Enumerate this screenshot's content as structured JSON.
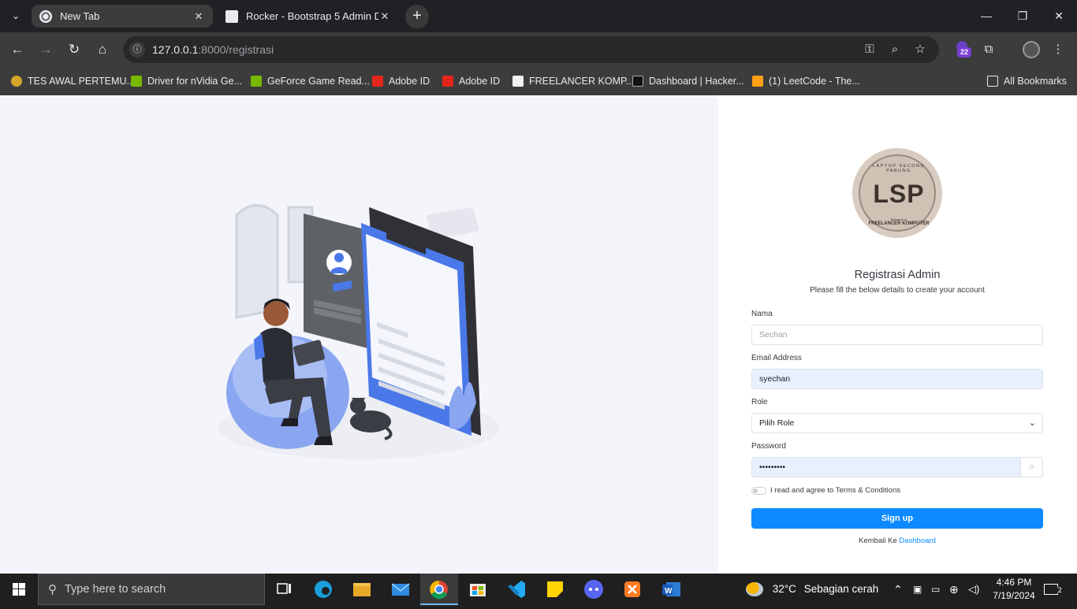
{
  "browser": {
    "tabs": [
      {
        "title": "New Tab",
        "active": true
      },
      {
        "title": "Rocker - Bootstrap 5 Admin Da",
        "active": false
      }
    ],
    "url_host": "127.0.0.1",
    "url_path": ":8000/registrasi",
    "extension_badge": "22",
    "bookmarks": [
      "TES AWAL PERTEMU...",
      "Driver for nVidia Ge...",
      "GeForce Game Read...",
      "Adobe ID",
      "Adobe ID",
      "FREELANCER KOMP...",
      "Dashboard | Hacker...",
      "(1) LeetCode - The..."
    ],
    "all_bookmarks": "All Bookmarks"
  },
  "logo": {
    "text": "LSP",
    "arc_text": "LAPTOP SECOND PABUNG",
    "subtitle_small": "Bersama di",
    "subtitle": "FREELANCER KOMPUTER"
  },
  "form": {
    "title": "Registrasi Admin",
    "subtitle": "Please fill the below details to create your account",
    "name_label": "Nama",
    "name_placeholder": "Sechan",
    "email_label": "Email Address",
    "email_value": "syechan",
    "role_label": "Role",
    "role_value": "Pilih Role",
    "password_label": "Password",
    "password_value": "•••••••••",
    "terms_label": "I read and agree to Terms & Conditions",
    "signup_label": "Sign up",
    "back_text": "Kembali Ke",
    "back_link": "Dashboard"
  },
  "taskbar": {
    "search_placeholder": "Type here to search",
    "weather_temp": "32°C",
    "weather_desc": "Sebagian cerah",
    "time": "4:46 PM",
    "date": "7/19/2024",
    "notification_count": "2"
  },
  "colors": {
    "accent": "#0d8aff",
    "hero_bg": "#f4f5fb",
    "illustration_blue": "#4a78e8",
    "autofill_bg": "#e8f0fe"
  }
}
